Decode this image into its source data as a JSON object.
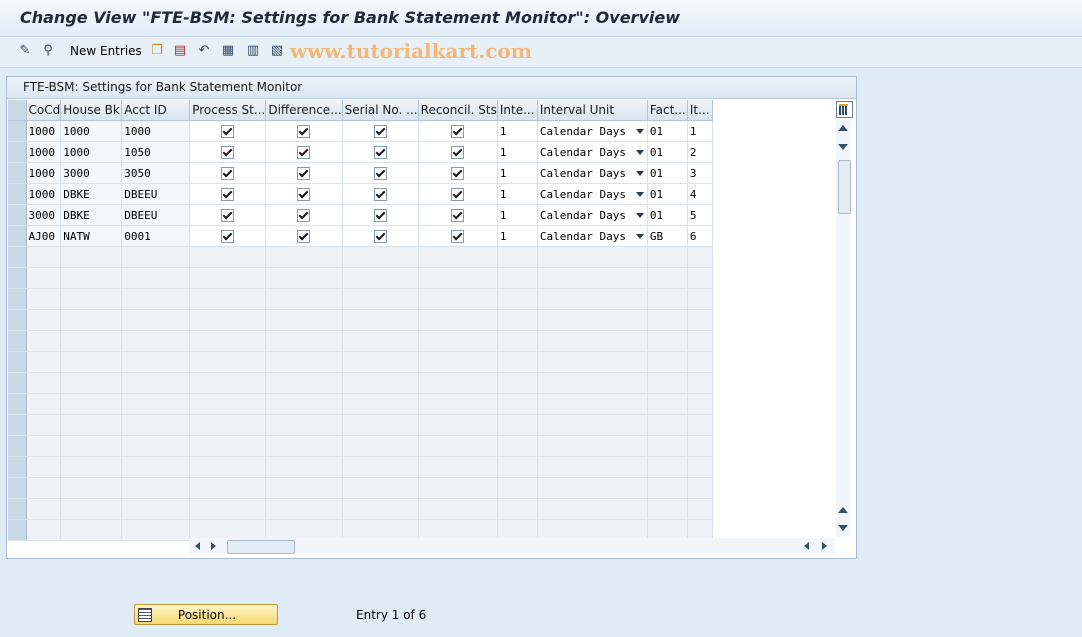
{
  "window": {
    "title": "Change View \"FTE-BSM: Settings for Bank Statement Monitor\": Overview"
  },
  "toolbar": {
    "new_entries_label": "New Entries",
    "watermark": "www.tutorialkart.com",
    "icons": [
      "edit-glasses-icon",
      "display-change-icon",
      "copy-icon",
      "delete-icon",
      "undo-icon",
      "select-all-icon",
      "select-block-icon",
      "deselect-all-icon"
    ]
  },
  "panel": {
    "title": "FTE-BSM: Settings for Bank Statement Monitor"
  },
  "table": {
    "columns": [
      "CoCd",
      "House Bk",
      "Acct ID",
      "Process St...",
      "Difference...",
      "Serial No. ...",
      "Reconcil. Sts",
      "Inte...",
      "Interval Unit",
      "Fact...",
      "It..."
    ],
    "rows": [
      {
        "cocd": "1000",
        "house_bk": "1000",
        "acct_id": "1000",
        "interval": "1",
        "interval_unit": "Calendar Days",
        "factory": "01",
        "item": "1"
      },
      {
        "cocd": "1000",
        "house_bk": "1000",
        "acct_id": "1050",
        "interval": "1",
        "interval_unit": "Calendar Days",
        "factory": "01",
        "item": "2"
      },
      {
        "cocd": "1000",
        "house_bk": "3000",
        "acct_id": "3050",
        "interval": "1",
        "interval_unit": "Calendar Days",
        "factory": "01",
        "item": "3"
      },
      {
        "cocd": "1000",
        "house_bk": "DBKE",
        "acct_id": "DBEEU",
        "interval": "1",
        "interval_unit": "Calendar Days",
        "factory": "01",
        "item": "4"
      },
      {
        "cocd": "3000",
        "house_bk": "DBKE",
        "acct_id": "DBEEU",
        "interval": "1",
        "interval_unit": "Calendar Days",
        "factory": "01",
        "item": "5"
      },
      {
        "cocd": "AJ00",
        "house_bk": "NATW",
        "acct_id": "0001",
        "interval": "1",
        "interval_unit": "Calendar Days",
        "factory": "GB",
        "item": "6"
      }
    ],
    "empty_rows": 14
  },
  "footer": {
    "position_label": "Position...",
    "entry_info": "Entry 1 of 6"
  }
}
